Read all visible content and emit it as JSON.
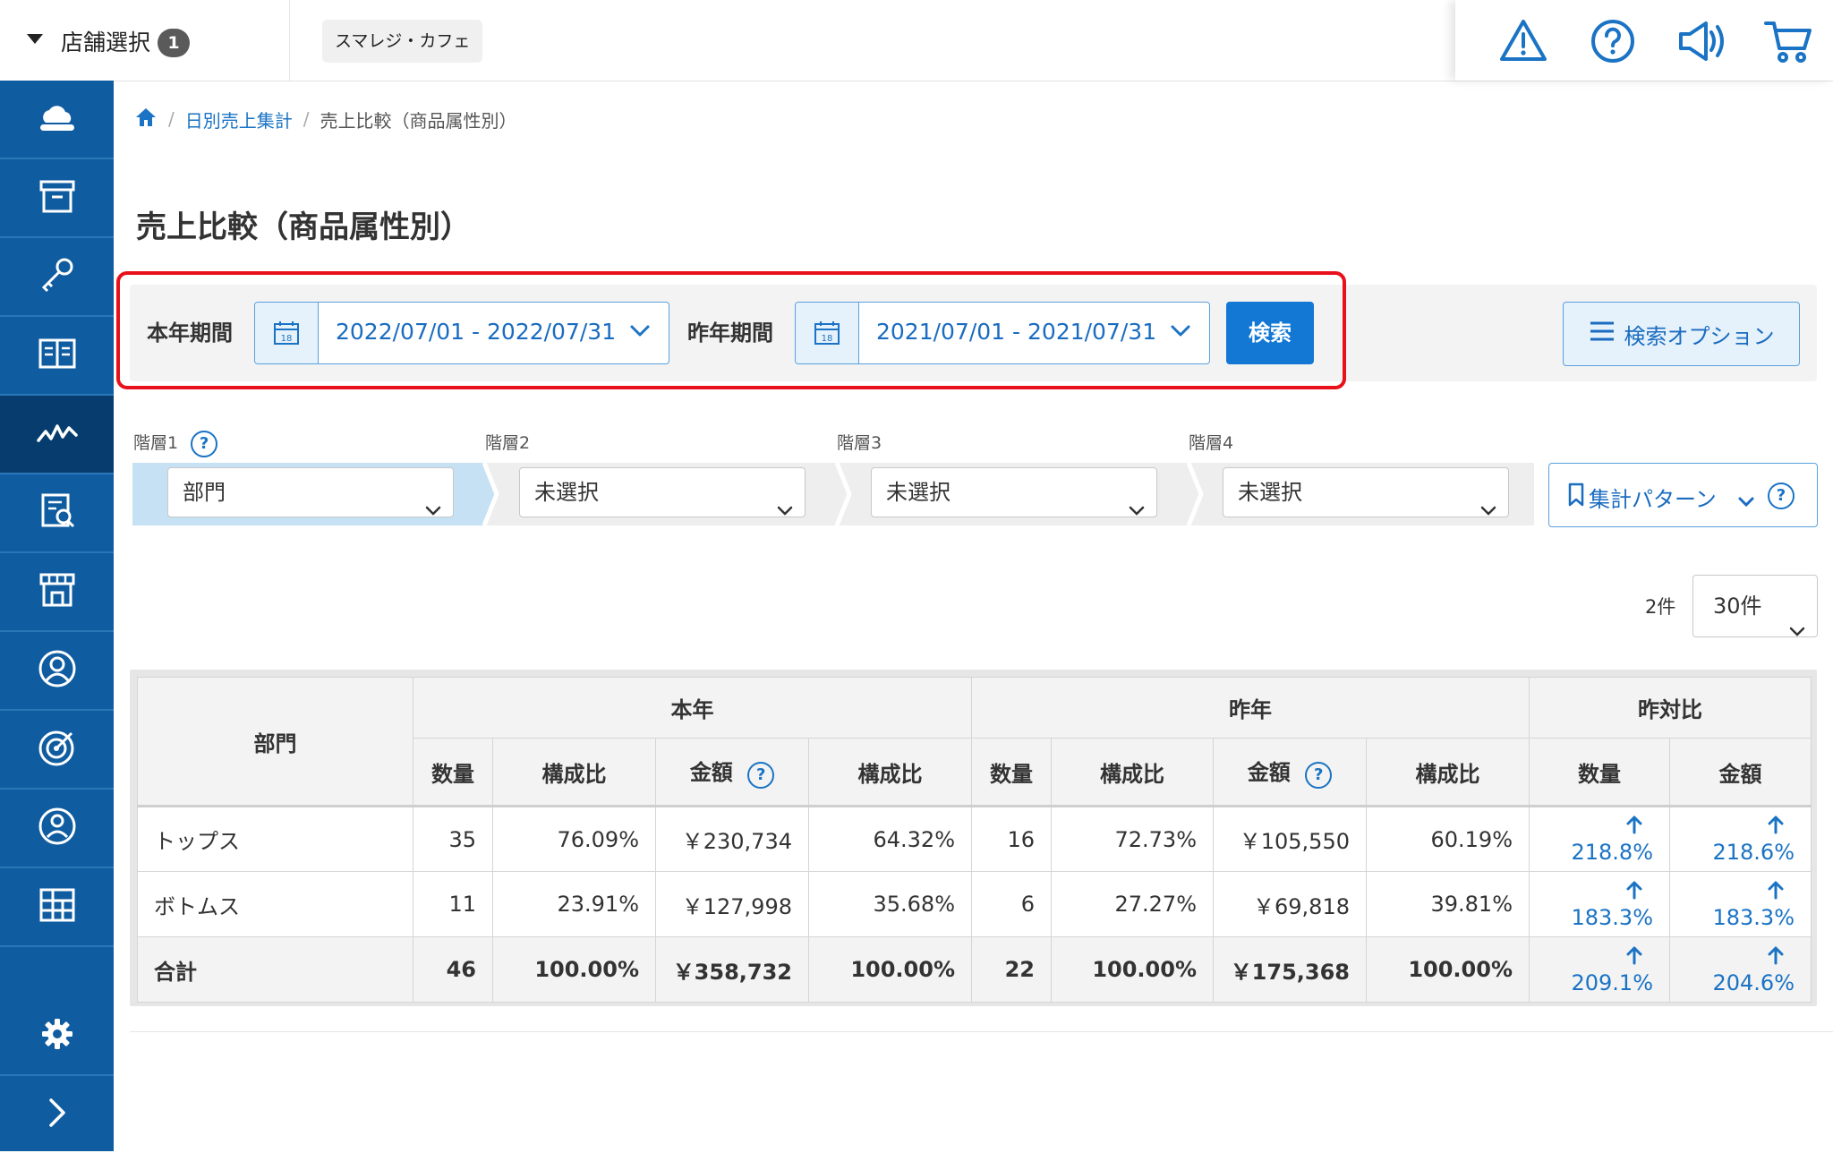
{
  "header": {
    "store_select_label": "店舗選択",
    "store_count": "1",
    "shop_name": "スマレジ・カフェ",
    "icons": [
      "warning-icon",
      "help-icon",
      "megaphone-icon",
      "cart-icon"
    ]
  },
  "sidebar": {
    "items": [
      "cloud-icon",
      "archive-icon",
      "key-icon",
      "book-icon",
      "chart-icon",
      "report-icon",
      "store-icon",
      "customer-icon",
      "target-icon",
      "user-icon",
      "grid-icon"
    ],
    "active_index": 4,
    "bottom": [
      "gear-icon",
      "chevron-right-icon"
    ]
  },
  "breadcrumb": {
    "home_icon": "home-icon",
    "link": "日別売上集計",
    "current": "売上比較（商品属性別）"
  },
  "page_title": "売上比較（商品属性別）",
  "search": {
    "this_year_label": "本年期間",
    "this_year_value": "2022/07/01 - 2022/07/31",
    "last_year_label": "昨年期間",
    "last_year_value": "2021/07/01 - 2021/07/31",
    "calendar_day": "18",
    "search_button": "検索",
    "option_button": "検索オプション"
  },
  "hierarchy": {
    "labels": [
      "階層1",
      "階層2",
      "階層3",
      "階層4"
    ],
    "values": [
      "部門",
      "未選択",
      "未選択",
      "未選択"
    ],
    "pattern_button": "集計パターン",
    "help": "?"
  },
  "results": {
    "count": "2件",
    "per_page": "30件"
  },
  "table": {
    "col_dept": "部門",
    "group_this_year": "本年",
    "group_last_year": "昨年",
    "group_ratio": "昨対比",
    "sub_qty": "数量",
    "sub_share": "構成比",
    "sub_amount": "金額",
    "rows": [
      {
        "name": "トップス",
        "qty": "35",
        "qty_share": "76.09%",
        "amount": "￥230,734",
        "amount_share": "64.32%",
        "ly_qty": "16",
        "ly_qty_share": "72.73%",
        "ly_amount": "￥105,550",
        "ly_amount_share": "60.19%",
        "ratio_qty": "218.8%",
        "ratio_amount": "218.6%"
      },
      {
        "name": "ボトムス",
        "qty": "11",
        "qty_share": "23.91%",
        "amount": "￥127,998",
        "amount_share": "35.68%",
        "ly_qty": "6",
        "ly_qty_share": "27.27%",
        "ly_amount": "￥69,818",
        "ly_amount_share": "39.81%",
        "ratio_qty": "183.3%",
        "ratio_amount": "183.3%"
      }
    ],
    "total": {
      "name": "合計",
      "qty": "46",
      "qty_share": "100.00%",
      "amount": "￥358,732",
      "amount_share": "100.00%",
      "ly_qty": "22",
      "ly_qty_share": "100.00%",
      "ly_amount": "￥175,368",
      "ly_amount_share": "100.00%",
      "ratio_qty": "209.1%",
      "ratio_amount": "204.6%"
    }
  },
  "colors": {
    "sidebar": "#0f5ca0",
    "sidebar_active": "#063d6e",
    "accent": "#1278d4",
    "highlight": "#e8101a",
    "link": "#1a73c4"
  }
}
